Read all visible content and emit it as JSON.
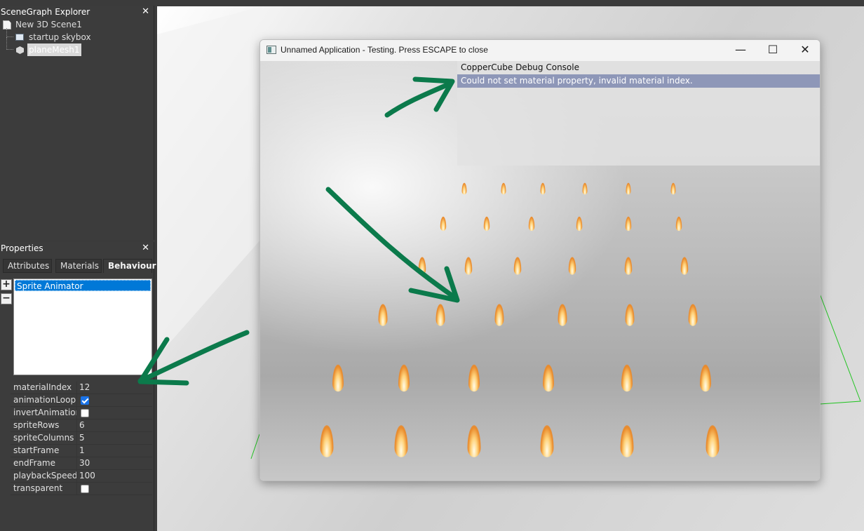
{
  "scene_explorer": {
    "title": "SceneGraph Explorer",
    "close_glyph": "✕",
    "nodes": [
      {
        "label": "New 3D Scene1"
      },
      {
        "label": "startup skybox"
      },
      {
        "label": "planeMesh1"
      }
    ]
  },
  "properties": {
    "title": "Properties",
    "close_glyph": "✕",
    "tabs": [
      {
        "label": "Attributes"
      },
      {
        "label": "Materials"
      },
      {
        "label": "Behaviour",
        "active": true
      }
    ],
    "add_glyph": "+",
    "remove_glyph": "−",
    "behaviours": [
      "Sprite Animator"
    ],
    "fields": [
      {
        "name": "materialIndex",
        "value": "12"
      },
      {
        "name": "animationLoop",
        "checked": true
      },
      {
        "name": "invertAnimation",
        "checked": false
      },
      {
        "name": "spriteRows",
        "value": "6"
      },
      {
        "name": "spriteColumns",
        "value": "5"
      },
      {
        "name": "startFrame",
        "value": "1"
      },
      {
        "name": "endFrame",
        "value": "30"
      },
      {
        "name": "playbackSpeedM",
        "value": "100"
      },
      {
        "name": "transparent",
        "checked": false
      }
    ]
  },
  "game_window": {
    "title": "Unnamed Application - Testing. Press ESCAPE to close",
    "minimize_glyph": "—",
    "maximize_glyph": "☐",
    "close_glyph": "✕",
    "console": {
      "title": "CopperCube Debug Console",
      "message": "Could not set material property, invalid material index."
    }
  },
  "colors": {
    "annotation_arrow": "#0b7a4b",
    "selection": "#0078d7",
    "console_highlight": "#8e97b8",
    "gizmo_line": "#22c422"
  }
}
